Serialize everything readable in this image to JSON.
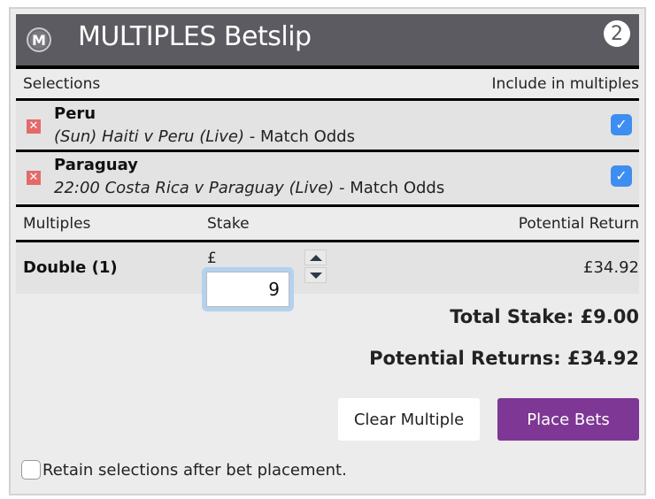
{
  "header": {
    "logo_letter": "M",
    "title": "MULTIPLES Betslip",
    "selection_count": "2"
  },
  "selections_header": {
    "left": "Selections",
    "right": "Include in multiples"
  },
  "selections": [
    {
      "name": "Peru",
      "event_italic": "(Sun) Haiti v Peru (Live)",
      "market": " - Match Odds",
      "included": true
    },
    {
      "name": "Paraguay",
      "event_italic": "22:00 Costa Rica v Paraguay (Live)",
      "market": " - Match Odds",
      "included": true
    }
  ],
  "multiples_header": {
    "multiples": "Multiples",
    "stake": "Stake",
    "return": "Potential Return"
  },
  "multiples": [
    {
      "name": "Double (1)",
      "currency": "£",
      "stake_value": "9",
      "potential_return": "£34.92"
    }
  ],
  "totals": {
    "total_stake": "Total Stake: £9.00",
    "potential_returns": "Potential Returns: £34.92"
  },
  "actions": {
    "clear_label": "Clear Multiple",
    "place_label": "Place Bets"
  },
  "retain": {
    "label": "Retain selections after bet placement.",
    "checked": false
  },
  "icons": {
    "remove": "✕",
    "check": "✓"
  },
  "colors": {
    "header_bg": "#5c5b61",
    "place_button": "#7e3794",
    "checkbox_blue": "#3d8ef0",
    "remove_red": "#e46a6a"
  }
}
